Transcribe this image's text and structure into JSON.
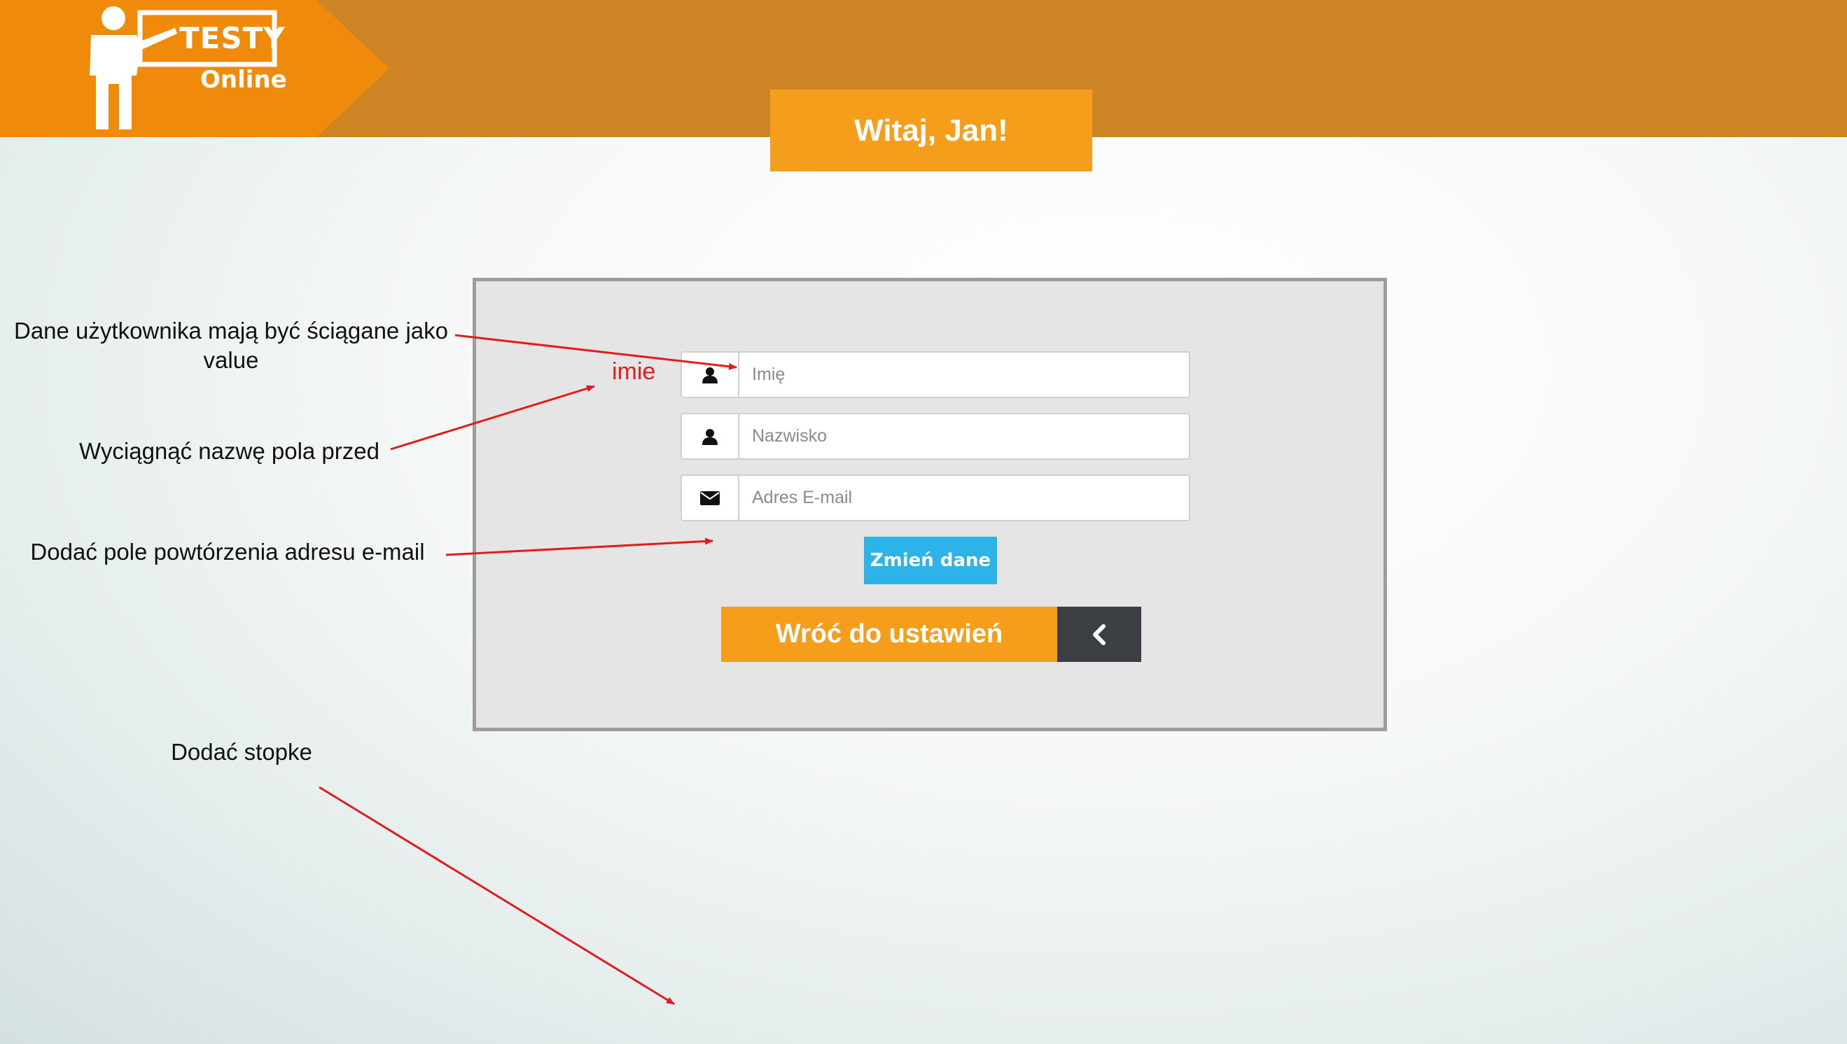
{
  "header": {
    "logo_line1": "TESTY",
    "logo_line2": "Online",
    "welcome": "Witaj, Jan!"
  },
  "form": {
    "first_name_placeholder": "Imię",
    "last_name_placeholder": "Nazwisko",
    "email_placeholder": "Adres E-mail",
    "submit_label": "Zmień dane",
    "back_label": "Wróć do ustawień"
  },
  "annotations": {
    "value_note": "Dane użytkownika mają być ściągane jako value",
    "field_name_label": "imie",
    "field_name_note": "Wyciągnąć nazwę pola przed",
    "repeat_email_note": "Dodać pole powtórzenia adresu e-mail",
    "footer_note": "Dodać stopke"
  },
  "colors": {
    "header_bar": "#cd8424",
    "accent_orange": "#f59e1b",
    "button_blue": "#2db3e8",
    "dark_button": "#3b3f44",
    "annotation_red": "#e31b1b"
  },
  "icons": [
    "user-icon",
    "user-icon",
    "envelope-icon",
    "chevron-left-icon",
    "teacher-logo-icon"
  ]
}
